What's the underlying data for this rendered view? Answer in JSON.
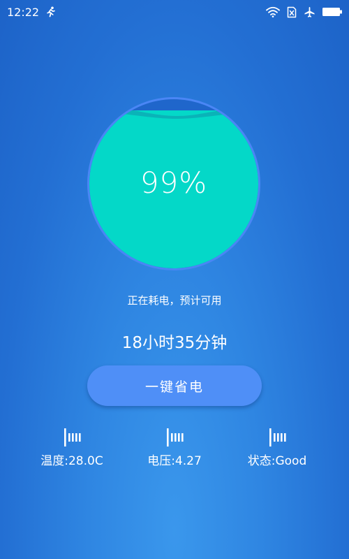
{
  "status_bar": {
    "time": "12:22",
    "icons": [
      "running-icon",
      "wifi-icon",
      "no-sim-icon",
      "airplane-mode-icon",
      "battery-icon"
    ]
  },
  "battery": {
    "percent_text": "99%",
    "level": 0.99,
    "fill_color": "#04d8c8",
    "ring_color": "#4a86f5"
  },
  "status_text": "正在耗电，预计可用",
  "remaining_time": "18小时35分钟",
  "save_button_label": "一键省电",
  "stats": [
    {
      "icon": "bar-signal-icon",
      "label": "温度:28.0C"
    },
    {
      "icon": "bar-signal-icon",
      "label": "电压:4.27"
    },
    {
      "icon": "bar-signal-icon",
      "label": "状态:Good"
    }
  ],
  "colors": {
    "background_top": "#1d63c8",
    "background_bottom": "#3a97ec",
    "button": "#4f8ff7"
  }
}
